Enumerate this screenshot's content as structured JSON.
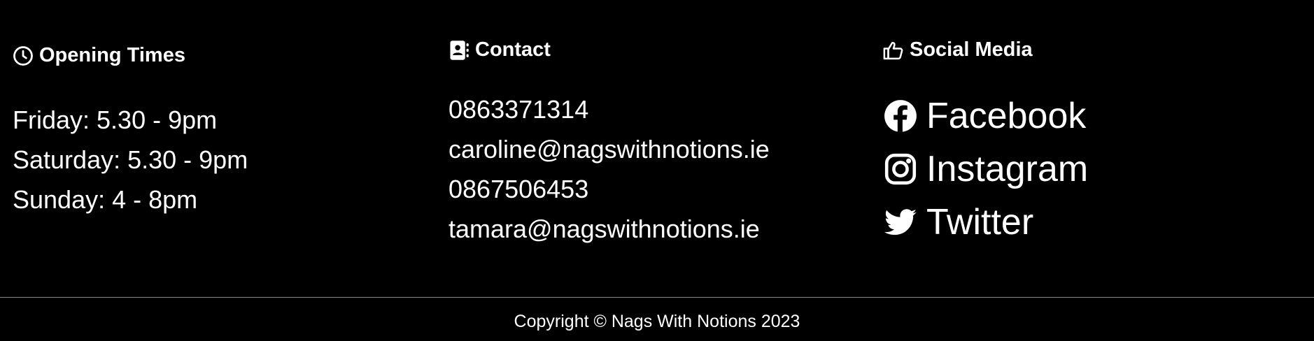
{
  "opening_times": {
    "title": "Opening Times",
    "icon": "clock-icon",
    "items": [
      "Friday: 5.30 - 9pm",
      "Saturday: 5.30 - 9pm",
      "Sunday: 4 - 8pm"
    ]
  },
  "contact": {
    "title": "Contact",
    "icon": "address-book-icon",
    "items": [
      "0863371314",
      "caroline@nagswithnotions.ie",
      "0867506453",
      "tamara@nagswithnotions.ie"
    ]
  },
  "social": {
    "title": "Social Media",
    "icon": "thumbs-up-icon",
    "links": [
      {
        "label": "Facebook",
        "icon": "facebook-icon"
      },
      {
        "label": "Instagram",
        "icon": "instagram-icon"
      },
      {
        "label": "Twitter",
        "icon": "twitter-icon"
      }
    ]
  },
  "footer": {
    "copyright": "Copyright © Nags With Notions 2023"
  },
  "colors": {
    "background": "#000000",
    "text": "#ffffff",
    "divider": "#8a8a8a"
  }
}
